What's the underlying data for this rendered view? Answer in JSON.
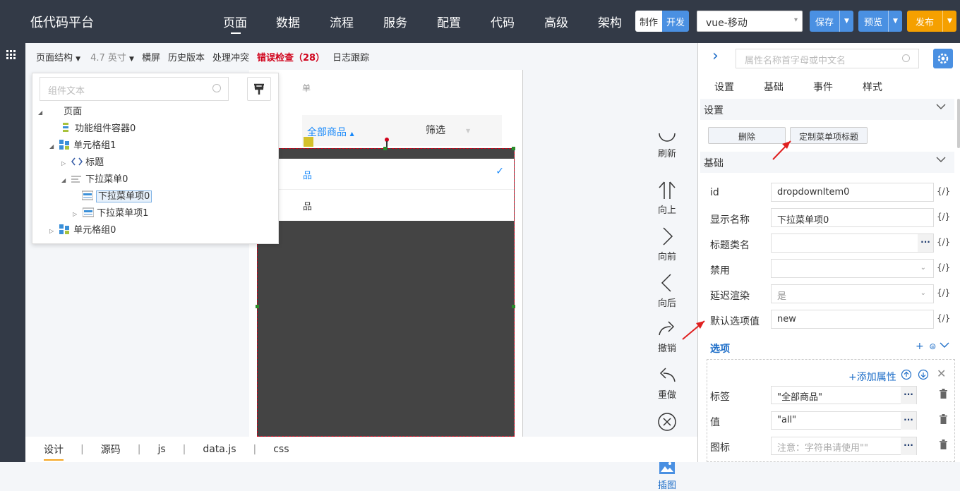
{
  "app": {
    "title": "低代码平台"
  },
  "topnav": [
    "页面",
    "数据",
    "流程",
    "服务",
    "配置",
    "代码",
    "高级",
    "架构"
  ],
  "mode": {
    "make_label": "制作",
    "dev_label": "开发",
    "target": "vue-移动"
  },
  "actions_top": {
    "save": "保存",
    "preview": "预览",
    "publish": "发布"
  },
  "colors": {
    "topbar": "#333a47",
    "accent_blue": "#4a90e2",
    "publish_orange": "#f5a000",
    "error_red": "#d0021b",
    "link_blue": "#1e6ec8"
  },
  "toolbar": {
    "page_structure": "页面结构",
    "screen_size": "4.7 英寸",
    "landscape": "横屏",
    "history": "历史版本",
    "conflict": "处理冲突",
    "error_check": "错误检查（28）",
    "log_trace": "日志跟踪"
  },
  "tree": {
    "search_placeholder": "组件文本",
    "nodes": [
      {
        "label": "页面",
        "icon": "page-icon"
      },
      {
        "label": "功能组件容器0",
        "icon": "container-icon"
      },
      {
        "label": "单元格组1",
        "icon": "cellgroup-icon"
      },
      {
        "label": "标题",
        "icon": "code-brackets-icon"
      },
      {
        "label": "下拉菜单0",
        "icon": "dropdown-menu-icon"
      },
      {
        "label": "下拉菜单项0",
        "icon": "dropdown-item-icon",
        "selected": true
      },
      {
        "label": "下拉菜单项1",
        "icon": "dropdown-item-icon"
      },
      {
        "label": "单元格组0",
        "icon": "cellgroup-icon"
      }
    ]
  },
  "phone": {
    "header_fragment": "单",
    "tab_all": "全部商品",
    "tab_filter": "筛选",
    "menu_item1": "品",
    "menu_item2": "品"
  },
  "canvas_actions": [
    {
      "label": "刷新",
      "icon": "refresh-icon"
    },
    {
      "label": "向上",
      "icon": "arrow-up-icon"
    },
    {
      "label": "向前",
      "icon": "chevron-right-icon"
    },
    {
      "label": "向后",
      "icon": "chevron-left-icon"
    },
    {
      "label": "撤销",
      "icon": "undo-icon"
    },
    {
      "label": "重做",
      "icon": "redo-icon"
    },
    {
      "label": "删除",
      "icon": "delete-circle-icon"
    },
    {
      "label": "插图",
      "icon": "image-icon"
    }
  ],
  "bottom_tabs": [
    "设计",
    "源码",
    "js",
    "data.js",
    "css"
  ],
  "props": {
    "search_placeholder": "属性名称首字母或中文名",
    "tabs": [
      "设置",
      "基础",
      "事件",
      "样式"
    ],
    "section_settings": "设置",
    "delete_btn": "删除",
    "customize_btn": "定制菜单项标题",
    "section_basic": "基础",
    "fields": [
      {
        "label": "id",
        "value": "dropdownItem0",
        "kind": "text"
      },
      {
        "label": "显示名称",
        "value": "下拉菜单项0",
        "kind": "text"
      },
      {
        "label": "标题类名",
        "value": "",
        "kind": "dots"
      },
      {
        "label": "禁用",
        "value": "",
        "kind": "select"
      },
      {
        "label": "延迟渲染",
        "value": "是",
        "kind": "select"
      },
      {
        "label": "默认选项值",
        "value": "new",
        "kind": "text"
      }
    ],
    "brace": "{/}",
    "options_title": "选项",
    "add_attr": "+添加属性",
    "option_rows": [
      {
        "label": "标签",
        "value": "\"全部商品\"",
        "placeholder": false
      },
      {
        "label": "值",
        "value": "\"all\"",
        "placeholder": false
      },
      {
        "label": "图标",
        "value": "注意：字符串请使用\"\"",
        "placeholder": true
      }
    ]
  }
}
